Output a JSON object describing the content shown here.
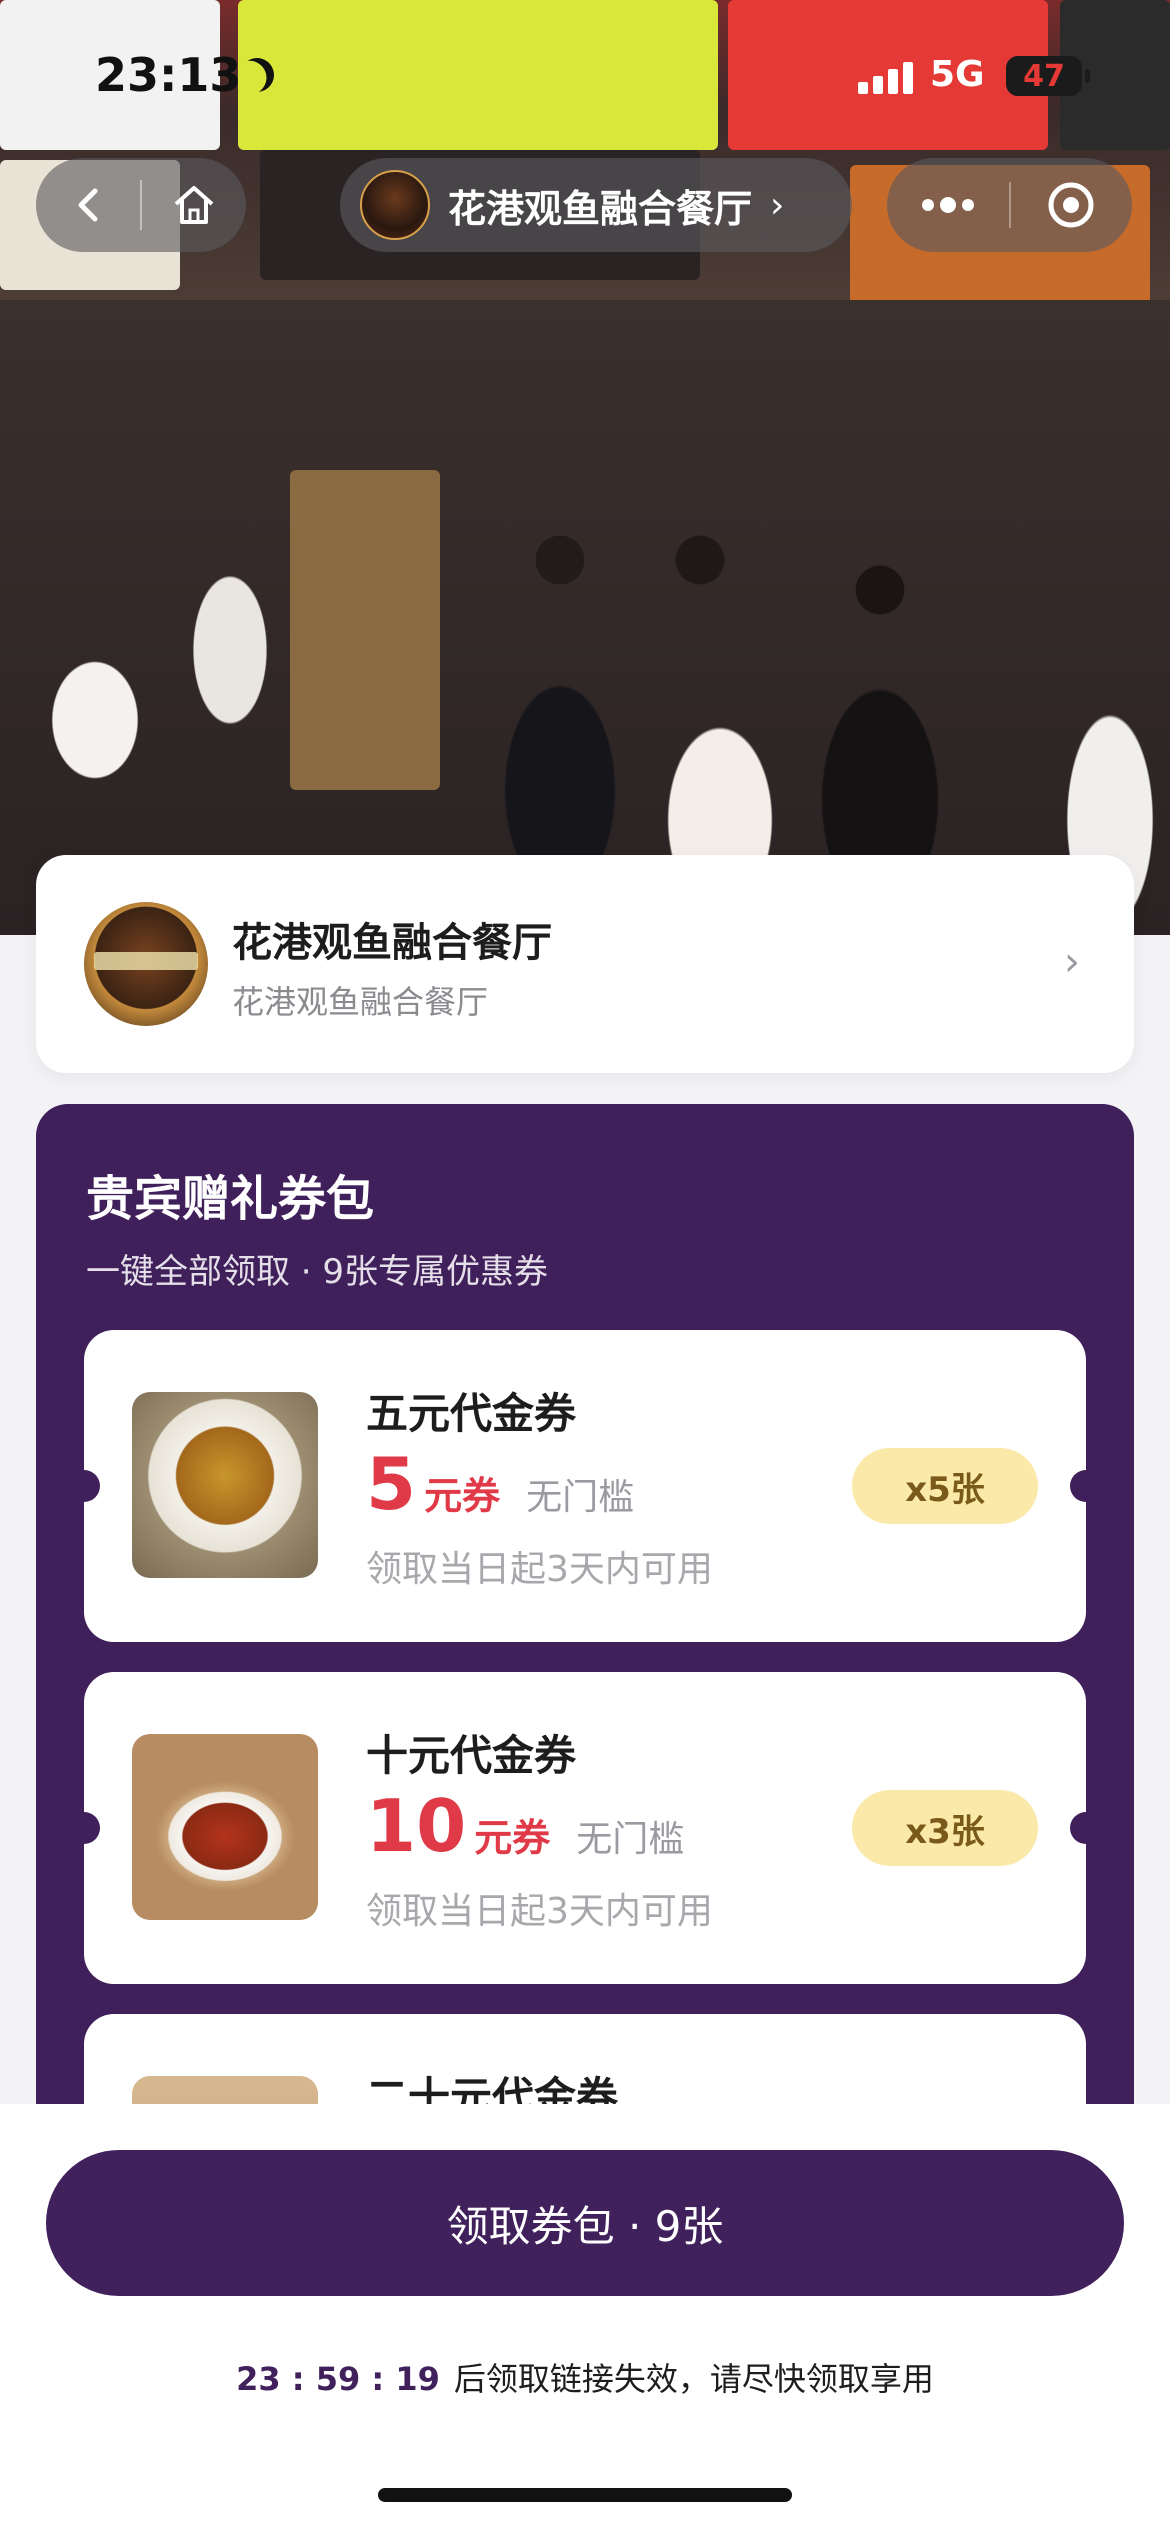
{
  "status_bar": {
    "time": "23:13",
    "network": "5G",
    "battery": "47"
  },
  "nav": {
    "shop_name": "花港观鱼融合餐厅"
  },
  "store": {
    "name": "花港观鱼融合餐厅",
    "subtitle": "花港观鱼融合餐厅"
  },
  "pack": {
    "title": "贵宾赠礼券包",
    "subtitle": "一键全部领取 · 9张专属优惠券",
    "coupons": [
      {
        "title": "五元代金券",
        "amount": "5",
        "unit": "元券",
        "threshold": "无门槛",
        "validity": "领取当日起3天内可用",
        "qty": "x5张"
      },
      {
        "title": "十元代金券",
        "amount": "10",
        "unit": "元券",
        "threshold": "无门槛",
        "validity": "领取当日起3天内可用",
        "qty": "x3张"
      },
      {
        "title": "二十元代金券"
      }
    ]
  },
  "footer": {
    "claim_button": "领取券包 · 9张",
    "countdown": "23 : 59 : 19",
    "expire_text": "后领取链接失效，请尽快领取享用"
  },
  "colors": {
    "primary_purple": "#41215b",
    "price_red": "#e03a48",
    "badge_yellow": "#fbe9a9"
  }
}
